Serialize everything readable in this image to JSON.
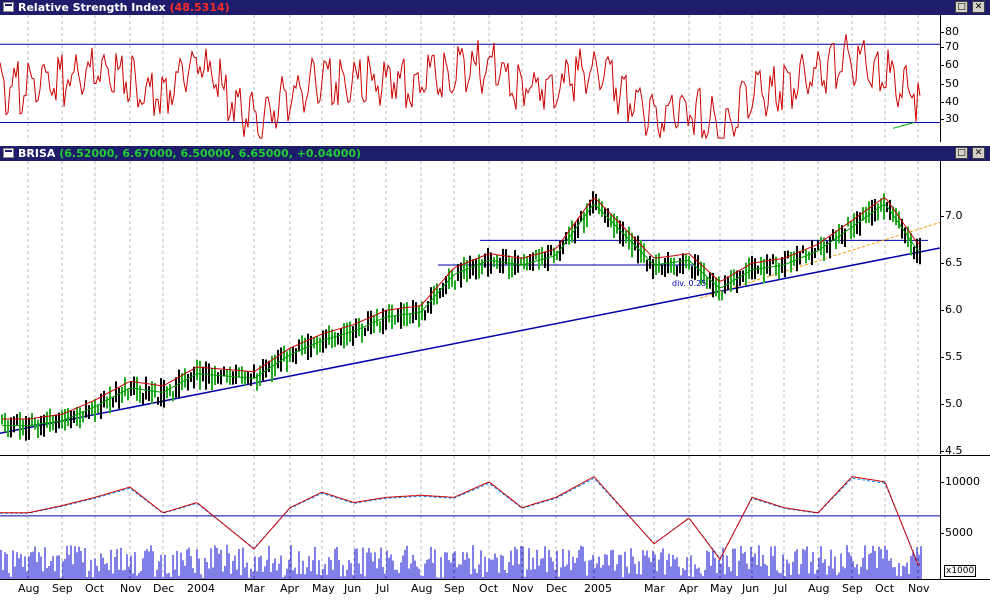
{
  "rsi_panel": {
    "title": "Relative Strength Index",
    "value": "(48.5314)",
    "y_ticks": [
      "80",
      "70",
      "60",
      "50",
      "40",
      "30"
    ]
  },
  "price_panel": {
    "title": "BRISA",
    "values": "(6.52000, 6.67000, 6.50000, 6.65000, +0.04000)",
    "y_ticks": [
      "7.0",
      "6.5",
      "6.0",
      "5.5",
      "5.0",
      "4.5"
    ],
    "annotation": "div. 0.25"
  },
  "volume_panel": {
    "y_ticks": [
      "10000",
      "5000"
    ],
    "multiplier": "x1000"
  },
  "window_buttons": {
    "minimize": "□",
    "close": "✕"
  },
  "x_axis_labels": [
    "Aug",
    "Sep",
    "Oct",
    "Nov",
    "Dec",
    "2004",
    "Mar",
    "Apr",
    "May",
    "Jun",
    "Jul",
    "Aug",
    "Sep",
    "Oct",
    "Nov",
    "Dec",
    "2005",
    "Mar",
    "Apr",
    "May",
    "Jun",
    "Jul",
    "Aug",
    "Sep",
    "Oct",
    "Nov"
  ],
  "colors": {
    "rsi_line": "#cc0000",
    "up_bar": "#22aa22",
    "down_bar": "#000000",
    "trendline": "#0000aa",
    "ma_fast": "#cc0000",
    "ma_slow": "#009900",
    "volume": "#0000cc",
    "title_bg": "#1d1d6b"
  },
  "chart_data": [
    {
      "type": "line",
      "title": "Relative Strength Index",
      "ylim": [
        20,
        85
      ],
      "reference_lines": [
        70,
        30
      ],
      "x": [
        "Aug",
        "Sep",
        "Oct",
        "Nov",
        "Dec",
        "2004",
        "Mar",
        "Apr",
        "May",
        "Jun",
        "Jul",
        "Aug",
        "Sep",
        "Oct",
        "Nov",
        "Dec",
        "2005",
        "Mar",
        "Apr",
        "May",
        "Jun",
        "Jul",
        "Aug",
        "Sep",
        "Oct",
        "Nov"
      ],
      "series": [
        {
          "values": [
            55,
            58,
            65,
            58,
            50,
            68,
            38,
            50,
            60,
            57,
            58,
            58,
            64,
            66,
            55,
            54,
            66,
            38,
            45,
            34,
            50,
            56,
            62,
            70,
            64,
            50
          ]
        }
      ]
    },
    {
      "type": "line",
      "title": "BRISA",
      "ylim": [
        4.4,
        7.5
      ],
      "x": [
        "Aug",
        "Sep",
        "Oct",
        "Nov",
        "Dec",
        "2004",
        "Mar",
        "Apr",
        "May",
        "Jun",
        "Jul",
        "Aug",
        "Sep",
        "Oct",
        "Nov",
        "Dec",
        "2005",
        "Mar",
        "Apr",
        "May",
        "Jun",
        "Jul",
        "Aug",
        "Sep",
        "Oct",
        "Nov"
      ],
      "series": [
        {
          "values": [
            4.75,
            4.8,
            4.95,
            5.15,
            5.1,
            5.3,
            5.25,
            5.5,
            5.65,
            5.75,
            5.9,
            5.95,
            6.35,
            6.5,
            6.45,
            6.55,
            7.1,
            6.45,
            6.5,
            6.2,
            6.4,
            6.45,
            6.6,
            6.85,
            7.1,
            6.6
          ]
        }
      ]
    },
    {
      "type": "bar",
      "title": "",
      "ylim": [
        0,
        12000
      ],
      "reference_lines": [
        6200
      ],
      "x": [
        "Aug",
        "Sep",
        "Oct",
        "Nov",
        "Dec",
        "2004",
        "Mar",
        "Apr",
        "May",
        "Jun",
        "Jul",
        "Aug",
        "Sep",
        "Oct",
        "Nov",
        "Dec",
        "2005",
        "Mar",
        "Apr",
        "May",
        "Jun",
        "Jul",
        "Aug",
        "Sep",
        "Oct",
        "Nov"
      ],
      "series": [
        {
          "values": [
            6500,
            7200,
            8000,
            9000,
            6500,
            7500,
            3000,
            7000,
            8500,
            7500,
            8000,
            8200,
            8000,
            9500,
            7000,
            8000,
            10000,
            3500,
            6000,
            2000,
            8000,
            7000,
            6500,
            10000,
            9500,
            1500
          ]
        }
      ]
    }
  ]
}
